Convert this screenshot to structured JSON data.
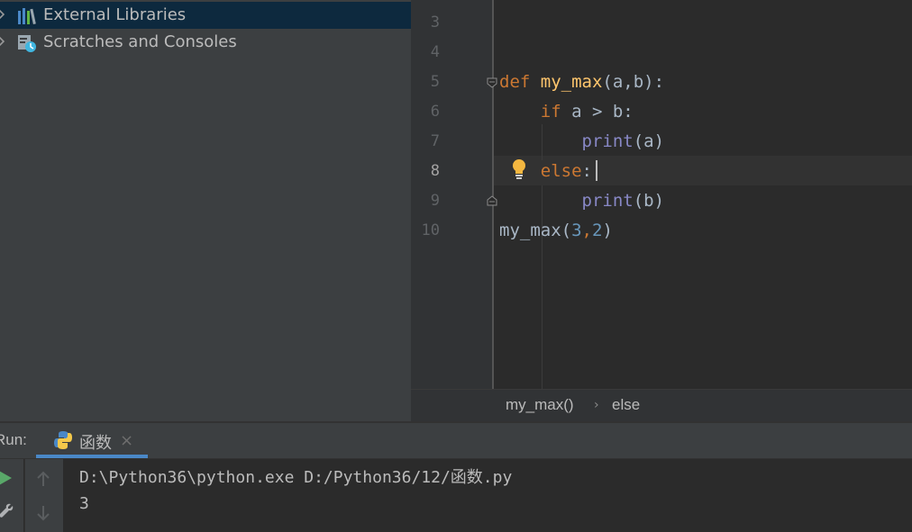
{
  "project_tree": {
    "items": [
      {
        "label": "External Libraries",
        "icon": "libraries-icon",
        "selected": true
      },
      {
        "label": "Scratches and Consoles",
        "icon": "scratches-icon",
        "selected": false
      }
    ]
  },
  "editor": {
    "line_numbers": [
      "3",
      "4",
      "5",
      "6",
      "7",
      "8",
      "9",
      "10"
    ],
    "current_line": "8",
    "code": {
      "l5_kw": "def",
      "l5_fn": "my_max",
      "l5_rest": "(a,b):",
      "l6_kw": "if",
      "l6_rest": " a > b:",
      "l7_bi": "print",
      "l7_rest": "(a)",
      "l8_kw": "else",
      "l8_rest": ":",
      "l9_bi": "print",
      "l9_rest": "(b)",
      "l10_name": "my_max(",
      "l10_n1": "3",
      "l10_comma": ",",
      "l10_n2": "2",
      "l10_end": ")"
    }
  },
  "breadcrumb": {
    "items": [
      "my_max()",
      "else"
    ],
    "separator": "›"
  },
  "run_panel": {
    "label": "Run:",
    "tab_label": "函数",
    "tab_close": "×",
    "console_lines": [
      "D:\\Python36\\python.exe D:/Python36/12/函数.py",
      "3"
    ]
  },
  "colors": {
    "keyword": "#cc7832",
    "function": "#ffc66d",
    "builtin": "#8888c6",
    "number": "#6897bb",
    "text": "#a9b7c6",
    "selection": "#0d293e",
    "accent": "#4a88c7"
  }
}
